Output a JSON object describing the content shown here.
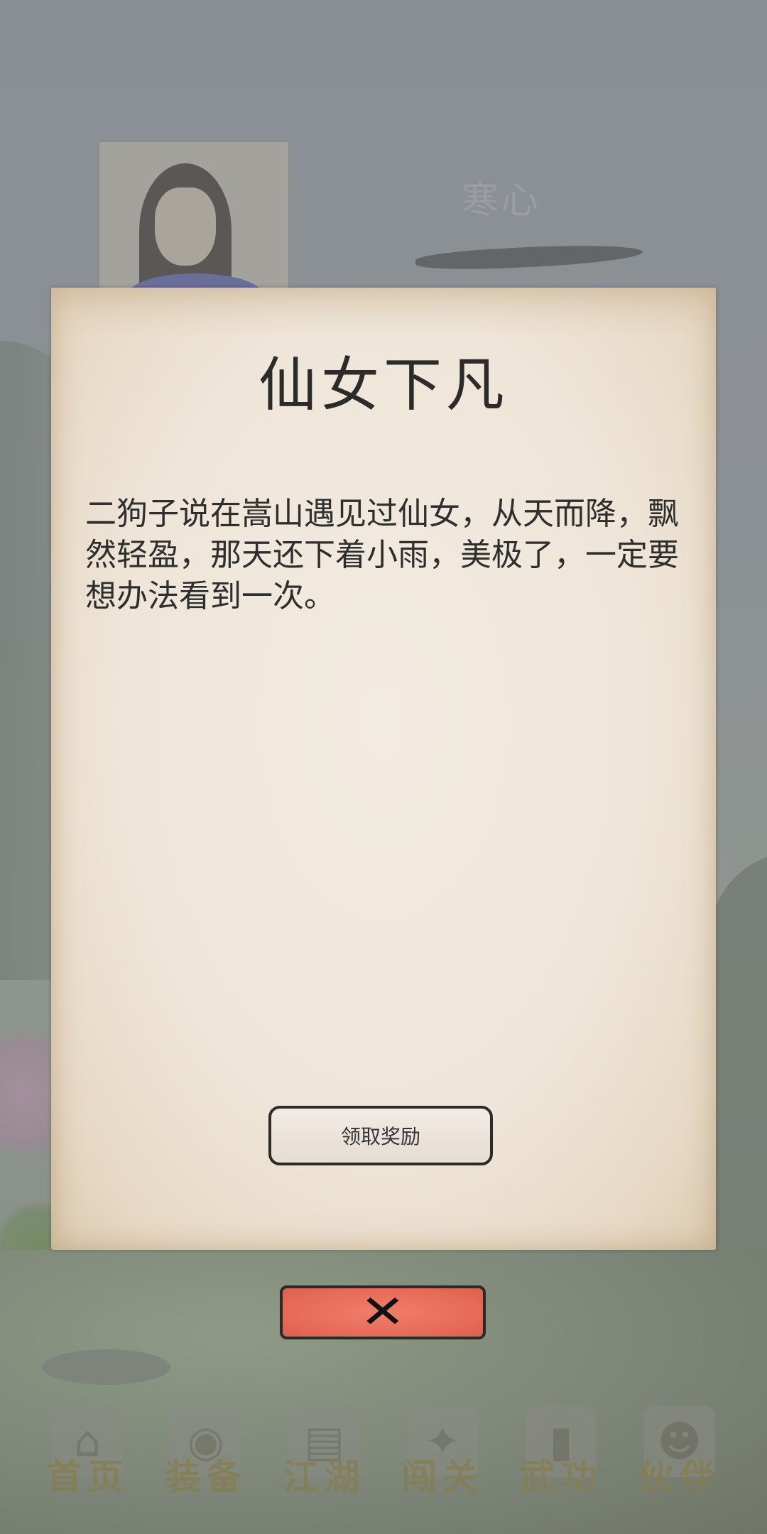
{
  "background": {
    "character_name": "寒心"
  },
  "dialog": {
    "title": "仙女下凡",
    "body": "二狗子说在嵩山遇见过仙女，从天而降，飘然轻盈，那天还下着小雨，美极了，一定要想办法看到一次。",
    "claim_button_label": "领取奖励"
  },
  "close_button": {
    "icon": "close-icon",
    "glyph": "✕"
  },
  "nav": {
    "items": [
      {
        "label": "首页",
        "icon": "home-icon"
      },
      {
        "label": "装备",
        "icon": "equipment-icon"
      },
      {
        "label": "江湖",
        "icon": "jianghu-icon"
      },
      {
        "label": "闯关",
        "icon": "challenge-icon"
      },
      {
        "label": "武功",
        "icon": "martial-arts-icon"
      },
      {
        "label": "伙伴",
        "icon": "partner-icon"
      }
    ]
  },
  "colors": {
    "dialog_paper": "#efe6d9",
    "close_button": "#e56a57",
    "title_text": "#2b2b2b"
  }
}
